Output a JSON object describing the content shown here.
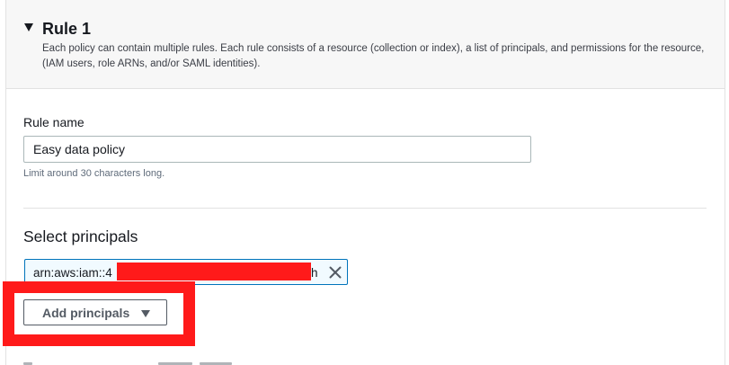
{
  "rule": {
    "title": "Rule 1",
    "description": "Each policy can contain multiple rules. Each rule consists of a resource (collection or index), a list of principals, and permissions for the resource, (IAM users, role ARNs, and/or SAML identities)."
  },
  "rule_name": {
    "label": "Rule name",
    "value": "Easy data policy",
    "hint": "Limit around 30 characters long."
  },
  "principals": {
    "heading": "Select principals",
    "tokens": [
      {
        "prefix": "arn:aws:iam::4",
        "suffix": "h",
        "remove_icon": "close-icon"
      }
    ],
    "add_button_label": "Add principals",
    "add_button_icon": "caret-down-icon"
  },
  "colors": {
    "token_border": "#0073bb",
    "token_background": "#f1faff",
    "annotation_red": "#ff1a1a",
    "header_background": "#f7f7f7"
  }
}
